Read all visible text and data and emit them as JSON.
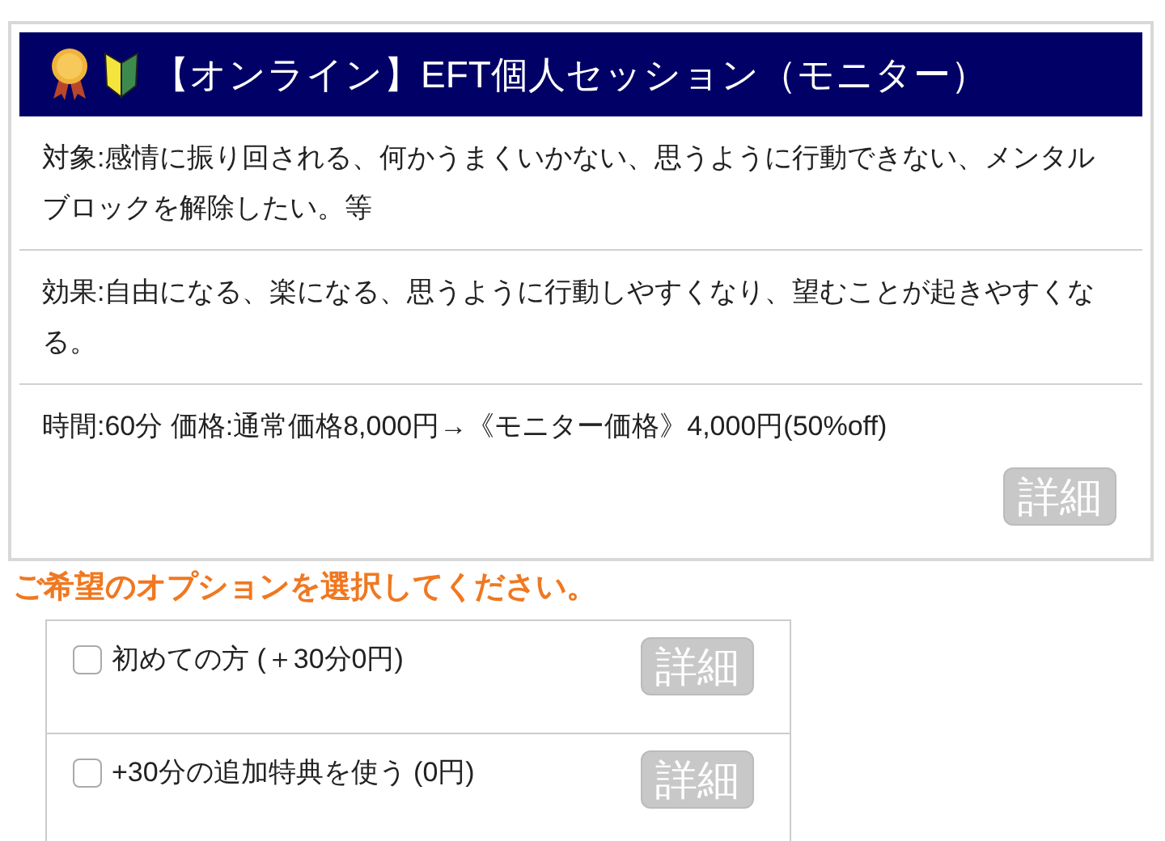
{
  "header": {
    "title": "【オンライン】EFT個人セッション（モニター）"
  },
  "rows": [
    {
      "text": "対象:感情に振り回される、何かうまくいかない、思うように行動できない、メンタルブロックを解除したい。等"
    },
    {
      "text": "効果:自由になる、楽になる、思うように行動しやすくなり、望むことが起きやすくなる。"
    },
    {
      "text": "時間:60分 価格:通常価格8,000円→《モニター価格》4,000円(50%off)"
    }
  ],
  "detail_button": "詳細",
  "options_heading": "ご希望のオプションを選択してください。",
  "options": [
    {
      "label": "初めての方 (＋30分0円)",
      "checked": false,
      "button": "詳細"
    },
    {
      "label": "+30分の追加特典を使う (0円)",
      "checked": false,
      "button": "詳細"
    }
  ]
}
